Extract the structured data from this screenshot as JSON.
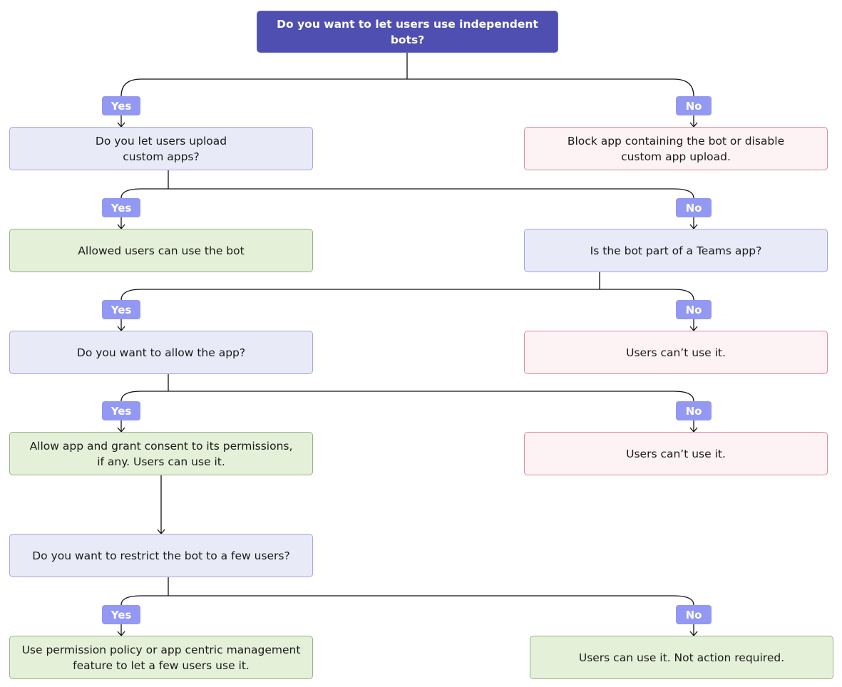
{
  "colors": {
    "question": "#e8eaf8",
    "negative": "#fdf2f4",
    "positive": "#e5f0d9",
    "root": "#4f4fb1",
    "label": "#9398f3"
  },
  "root": "Do you want to let users use independent bots?",
  "nodes": {
    "q1": "Do you let users upload\ncustom apps?",
    "block": "Block app containing the bot or disable\ncustom app upload.",
    "allowed": "Allowed users can use the bot",
    "q2": "Is the bot part of a Teams app?",
    "q3": "Do you want to allow the app?",
    "cant1": "Users can’t use it.",
    "allow": "Allow app and grant consent to its permissions,\nif any. Users can use it.",
    "cant2": "Users can’t use it.",
    "q4": "Do you want to restrict the bot to a few users?",
    "policy": "Use permission policy or app centric management\nfeature to let a few users use it.",
    "noaction": "Users can use it. Not action required."
  },
  "labels": {
    "yes": "Yes",
    "no": "No"
  }
}
